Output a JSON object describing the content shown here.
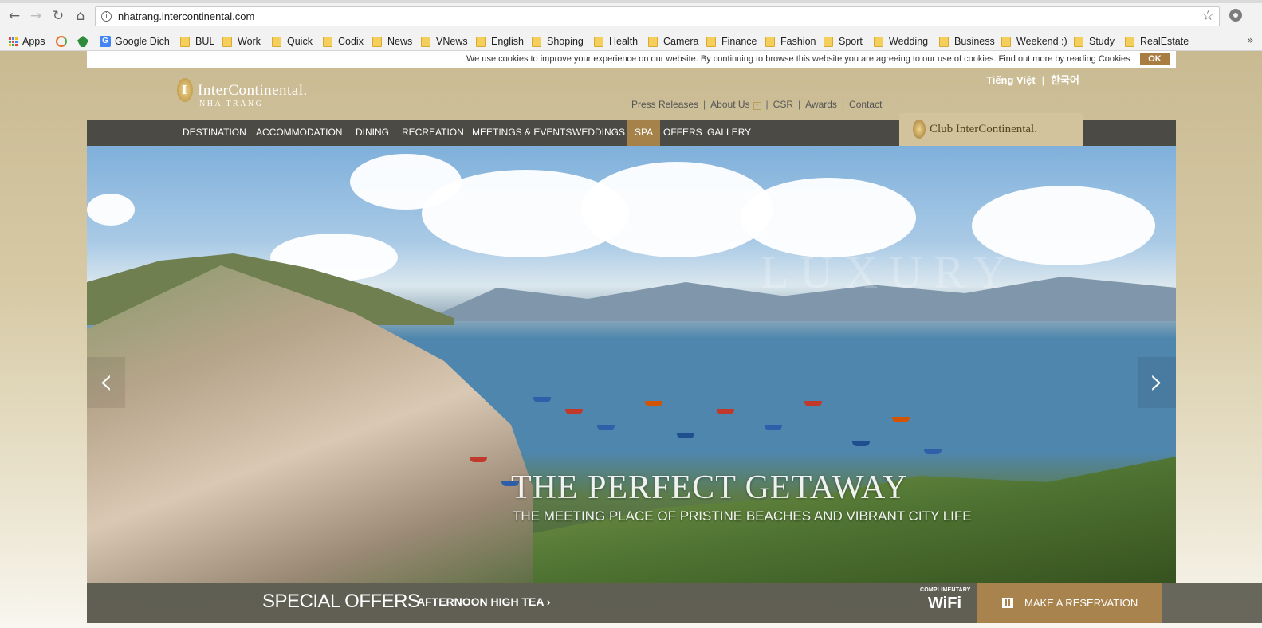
{
  "browser": {
    "url": "nhatrang.intercontinental.com",
    "nav_icons": [
      "back-arrow-icon",
      "forward-arrow-icon",
      "reload-icon",
      "home-icon"
    ],
    "bookmarks": [
      {
        "label": "Apps",
        "icon": "apps-grid-icon"
      },
      {
        "label": "",
        "icon": "refresh-extension-icon"
      },
      {
        "label": "",
        "icon": "leaf-extension-icon"
      },
      {
        "label": "Google Dich",
        "icon": "google-translate-icon"
      },
      {
        "label": "BUL",
        "icon": "folder-icon"
      },
      {
        "label": "Work",
        "icon": "folder-icon"
      },
      {
        "label": "Quick",
        "icon": "folder-icon"
      },
      {
        "label": "Codix",
        "icon": "folder-icon"
      },
      {
        "label": "News",
        "icon": "folder-icon"
      },
      {
        "label": "VNews",
        "icon": "folder-icon"
      },
      {
        "label": "English",
        "icon": "folder-icon"
      },
      {
        "label": "Shoping",
        "icon": "folder-icon"
      },
      {
        "label": "Health",
        "icon": "folder-icon"
      },
      {
        "label": "Camera",
        "icon": "folder-icon"
      },
      {
        "label": "Finance",
        "icon": "folder-icon"
      },
      {
        "label": "Fashion",
        "icon": "folder-icon"
      },
      {
        "label": "Sport",
        "icon": "folder-icon"
      },
      {
        "label": "Wedding",
        "icon": "folder-icon"
      },
      {
        "label": "Business",
        "icon": "folder-icon"
      },
      {
        "label": "Weekend :)",
        "icon": "folder-icon"
      },
      {
        "label": "Study",
        "icon": "folder-icon"
      },
      {
        "label": "RealEstate",
        "icon": "folder-icon"
      }
    ],
    "more": "»"
  },
  "cookie_banner": {
    "text": "We use cookies to improve your experience on our website. By continuing to browse this website you are agreeing to our use of cookies. Find out more by reading Cookies",
    "ok_label": "OK"
  },
  "header": {
    "logo_name": "InterContinental.",
    "logo_sub": "NHA TRANG",
    "languages": [
      "Tiếng Việt",
      "한국어"
    ],
    "language_sep": "|",
    "top_links": [
      "Press Releases",
      "About Us",
      "CSR",
      "Awards",
      "Contact"
    ],
    "top_link_sep": "|",
    "about_plus": "+",
    "club_label": "Club InterContinental."
  },
  "nav": {
    "items": [
      "DESTINATION",
      "ACCOMMODATION",
      "DINING",
      "RECREATION",
      "MEETINGS & EVENTS",
      "WEDDINGS",
      "SPA",
      "OFFERS",
      "GALLERY"
    ],
    "active": "SPA"
  },
  "hero": {
    "title": "THE PERFECT GETAWAY",
    "subtitle": "THE MEETING PLACE OF PRISTINE BEACHES AND VIBRANT CITY LIFE",
    "watermark": "LUXURY",
    "prev_arrow": "‹",
    "next_arrow": "›"
  },
  "bottom_bar": {
    "special_offers": "SPECIAL OFFERS",
    "offer_link": "AFTERNOON HIGH TEA ›",
    "wifi_small": "COMPLIMENTARY",
    "wifi_big": "WiFi",
    "reserve_label": "MAKE A RESERVATION"
  },
  "colors": {
    "gold": "#a8834d",
    "nav_bg": "#4b4a45",
    "page_bg": "#c9ba92"
  }
}
